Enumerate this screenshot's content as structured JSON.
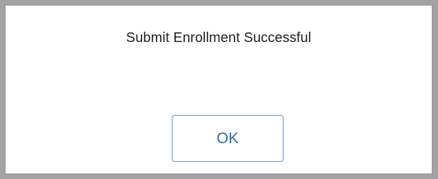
{
  "dialog": {
    "message": "Submit Enrollment Successful",
    "ok_label": "OK"
  },
  "colors": {
    "accent": "#2e6bb8",
    "button_border": "#5b8ed1",
    "backdrop": "#a3a3a3",
    "text": "#1f1f1f"
  }
}
